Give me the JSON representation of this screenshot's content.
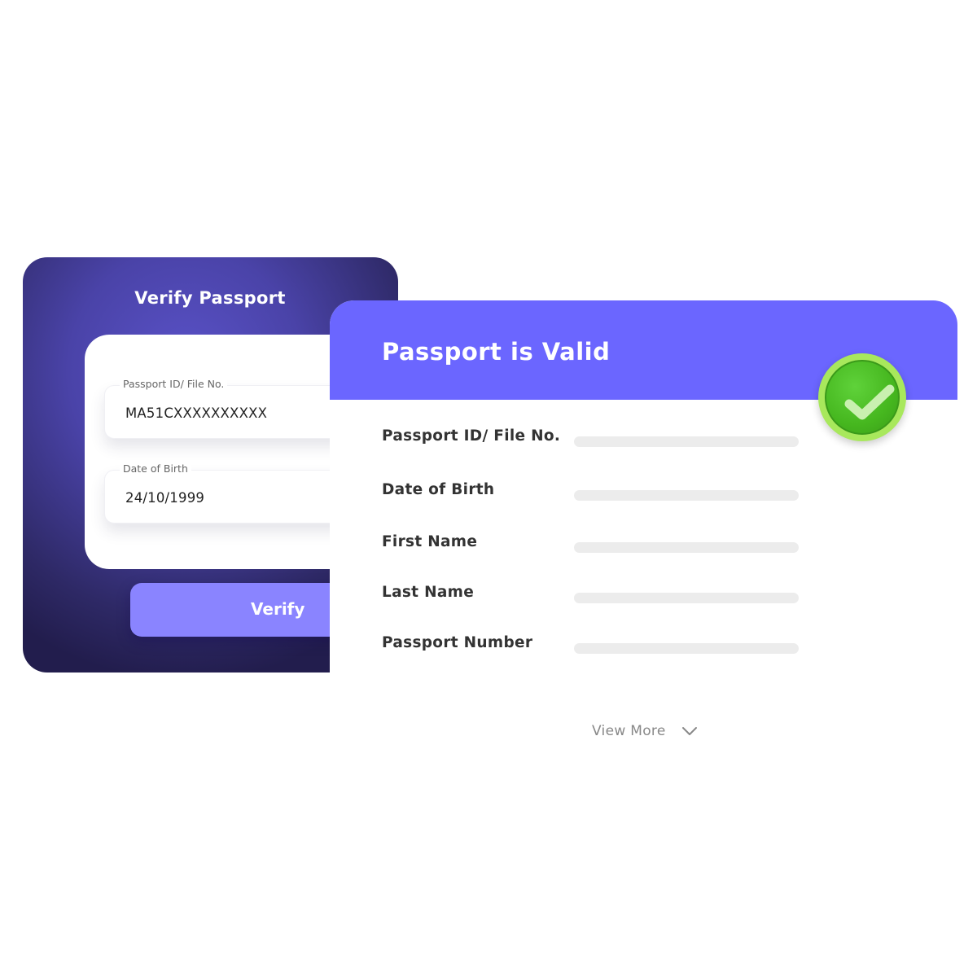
{
  "verify_card": {
    "title": "Verify Passport",
    "fields": [
      {
        "label": "Passport ID/ File No.",
        "value": "MA51CXXXXXXXXXX"
      },
      {
        "label": "Date of Birth",
        "value": "24/10/1999"
      }
    ],
    "button_label": "Verify"
  },
  "result_card": {
    "title": "Passport is Valid",
    "status_icon": "check-circle-icon",
    "rows": [
      {
        "label": "Passport ID/ File No."
      },
      {
        "label": "Date of Birth"
      },
      {
        "label": "First Name"
      },
      {
        "label": "Last Name"
      },
      {
        "label": "Passport Number"
      }
    ],
    "view_more_label": "View More",
    "view_more_icon": "chevron-down-icon"
  },
  "colors": {
    "card_dark": "#2e2966",
    "card_mid": "#5a52c8",
    "header_accent": "#6b66ff",
    "button": "#8a84ff",
    "success": "#46b71f",
    "placeholder_bar": "#ececec"
  }
}
